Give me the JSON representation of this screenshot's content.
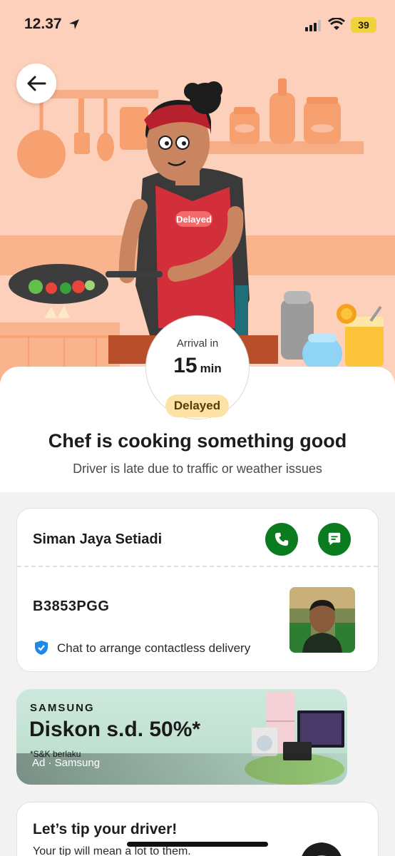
{
  "status_bar": {
    "time": "12.37",
    "battery": "39"
  },
  "hero": {
    "arrival_label": "Arrival in",
    "arrival_minutes": "15",
    "arrival_unit": "min",
    "status_badge": "Delayed",
    "headline": "Chef is cooking something good",
    "subline": "Driver is late due to traffic or weather issues"
  },
  "driver": {
    "name": "Siman Jaya Setiadi",
    "plate": "B3853PGG",
    "contactless_note": "Chat to arrange contactless delivery"
  },
  "ad": {
    "brand": "SAMSUNG",
    "promo": "Diskon s.d. 50%*",
    "terms": "*S&K berlaku",
    "label": "Ad · Samsung"
  },
  "tip": {
    "title": "Let’s tip your driver!",
    "subtitle": "Your tip will mean a lot to them."
  },
  "colors": {
    "accent_green": "#0a7c1f",
    "hero_bg": "#fcd0bb",
    "delayed_badge": "#fde2a8"
  }
}
